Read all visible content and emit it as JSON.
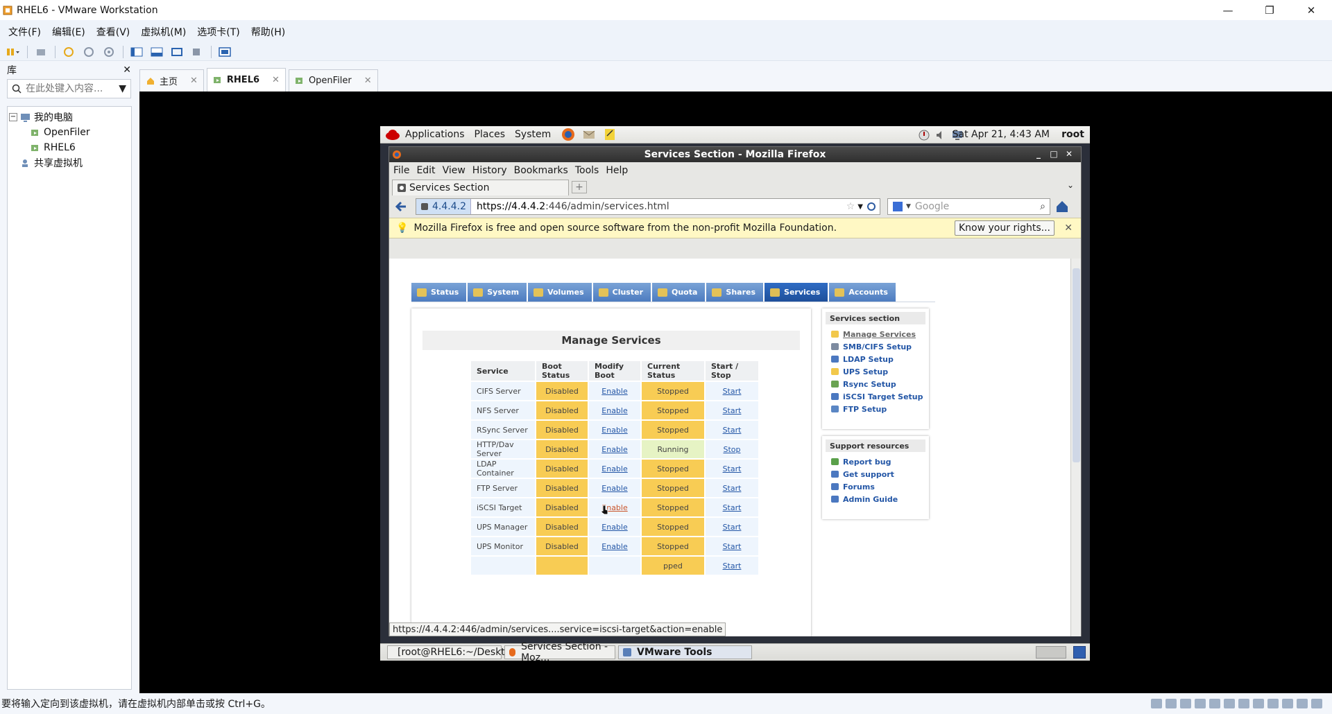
{
  "window": {
    "title": "RHEL6 - VMware Workstation",
    "controls": [
      "minimize-icon",
      "restore-icon",
      "close-icon"
    ]
  },
  "menubar": [
    "文件(F)",
    "编辑(E)",
    "查看(V)",
    "虚拟机(M)",
    "选项卡(T)",
    "帮助(H)"
  ],
  "library": {
    "title": "库",
    "search_placeholder": "在此处键入内容...",
    "tree": {
      "root": "我的电脑",
      "children": [
        "OpenFiler",
        "RHEL6"
      ],
      "shared": "共享虚拟机"
    }
  },
  "vm_tabs": [
    {
      "label": "主页",
      "icon": "home-icon"
    },
    {
      "label": "RHEL6",
      "icon": "vm-running-icon",
      "active": true
    },
    {
      "label": "OpenFiler",
      "icon": "vm-icon"
    }
  ],
  "statusbar": {
    "text": "要将输入定向到该虚拟机，请在虚拟机内部单击或按 Ctrl+G。"
  },
  "guest": {
    "top_panel": {
      "menus": [
        "Applications",
        "Places",
        "System"
      ],
      "clock": "Sat Apr 21,  4:43 AM",
      "user": "root"
    },
    "firefox": {
      "title": "Services Section - Mozilla Firefox",
      "menu": [
        "File",
        "Edit",
        "View",
        "History",
        "Bookmarks",
        "Tools",
        "Help"
      ],
      "tab_label": "Services Section",
      "site_identity": "4.4.4.2",
      "url_host": "https://4.4.4.2",
      "url_path": ":446/admin/services.html",
      "search_placeholder": "Google",
      "notification": "Mozilla Firefox is free and open source software from the non-profit Mozilla Foundation.",
      "notification_button": "Know your rights...",
      "status_url": "https://4.4.4.2:446/admin/services....service=iscsi-target&action=enable"
    },
    "taskbar": [
      {
        "label": "[root@RHEL6:~/Deskt...",
        "icon": "terminal-icon"
      },
      {
        "label": "Services Section - Moz...",
        "icon": "firefox-icon"
      },
      {
        "label": "VMware Tools",
        "icon": "folder-icon",
        "active": true
      }
    ]
  },
  "openfiler": {
    "nav_tabs": [
      "Status",
      "System",
      "Volumes",
      "Cluster",
      "Quota",
      "Shares",
      "Services",
      "Accounts"
    ],
    "active_tab": "Services",
    "heading": "Manage Services",
    "table": {
      "headers": [
        "Service",
        "Boot Status",
        "Modify Boot",
        "Current Status",
        "Start / Stop"
      ],
      "rows": [
        {
          "service": "CIFS Server",
          "boot": "Disabled",
          "modify": "Enable",
          "current": "Stopped",
          "action": "Start"
        },
        {
          "service": "NFS Server",
          "boot": "Disabled",
          "modify": "Enable",
          "current": "Stopped",
          "action": "Start"
        },
        {
          "service": "RSync Server",
          "boot": "Disabled",
          "modify": "Enable",
          "current": "Stopped",
          "action": "Start"
        },
        {
          "service": "HTTP/Dav Server",
          "boot": "Disabled",
          "modify": "Enable",
          "current": "Running",
          "action": "Stop"
        },
        {
          "service": "LDAP Container",
          "boot": "Disabled",
          "modify": "Enable",
          "current": "Stopped",
          "action": "Start"
        },
        {
          "service": "FTP Server",
          "boot": "Disabled",
          "modify": "Enable",
          "current": "Stopped",
          "action": "Start"
        },
        {
          "service": "iSCSI Target",
          "boot": "Disabled",
          "modify": "Enable",
          "current": "Stopped",
          "action": "Start"
        },
        {
          "service": "UPS Manager",
          "boot": "Disabled",
          "modify": "Enable",
          "current": "Stopped",
          "action": "Start"
        },
        {
          "service": "UPS Monitor",
          "boot": "Disabled",
          "modify": "Enable",
          "current": "Stopped",
          "action": "Start"
        },
        {
          "service": "",
          "boot": "",
          "modify": "",
          "current": "pped",
          "action": "Start"
        }
      ]
    },
    "services_section": {
      "title": "Services section",
      "links": [
        "Manage Services",
        "SMB/CIFS Setup",
        "LDAP Setup",
        "UPS Setup",
        "Rsync Setup",
        "iSCSI Target Setup",
        "FTP Setup"
      ]
    },
    "support": {
      "title": "Support resources",
      "links": [
        "Report bug",
        "Get support",
        "Forums",
        "Admin Guide"
      ]
    }
  },
  "colors": {
    "disabled_cell": "#f8cc54",
    "running_cell": "#e6f3c4",
    "nav_tab": "#5b87c8",
    "nav_tab_active": "#2258aa",
    "link": "#2356a6"
  }
}
